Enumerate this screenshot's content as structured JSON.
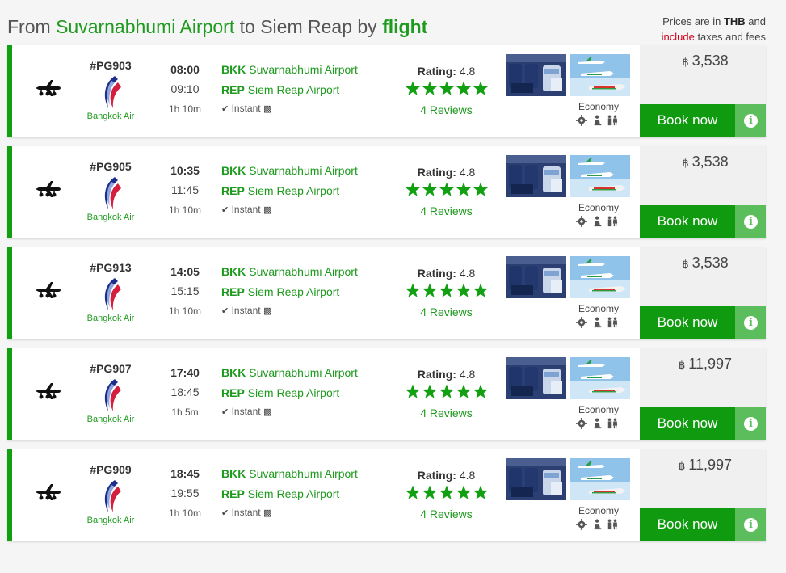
{
  "header": {
    "title_from": "From ",
    "title_origin": "Suvarnabhumi Airport",
    "title_to": " to ",
    "title_destination": "Siem Reap",
    "title_by": " by ",
    "title_mode": "flight",
    "prices_line1_prefix": "Prices are in ",
    "prices_currency": "THB",
    "prices_line1_suffix": " and",
    "prices_include": "include",
    "prices_line2_suffix": " taxes and fees"
  },
  "colors": {
    "accent_green": "#1e9a1e",
    "book_button": "#109a10",
    "info_button": "#5cbd5c",
    "note_red": "#d0021b"
  },
  "labels": {
    "rating_label": "Rating:",
    "instant_label": "Instant",
    "book_label": "Book now",
    "cabin_label": "Economy",
    "airline_name": "Bangkok Air",
    "dep_code": "BKK",
    "dep_airport": "Suvarnabhumi Airport",
    "arr_code": "REP",
    "arr_airport": "Siem Reap Airport",
    "currency_symbol": "฿",
    "info_symbol": "i"
  },
  "icons": {
    "transport": "airplane-icon",
    "instant": "check-icon",
    "luggage": "luggage-icon",
    "amenity1": "settings-icon",
    "amenity2": "seat-icon",
    "amenity3": "restroom-icon",
    "info": "info-icon"
  },
  "flights": [
    {
      "number": "#PG903",
      "depart": "08:00",
      "arrive": "09:10",
      "duration": "1h 10m",
      "rating": "4.8",
      "stars": 5,
      "reviews": "4 Reviews",
      "price": "3,538"
    },
    {
      "number": "#PG905",
      "depart": "10:35",
      "arrive": "11:45",
      "duration": "1h 10m",
      "rating": "4.8",
      "stars": 5,
      "reviews": "4 Reviews",
      "price": "3,538"
    },
    {
      "number": "#PG913",
      "depart": "14:05",
      "arrive": "15:15",
      "duration": "1h 10m",
      "rating": "4.8",
      "stars": 5,
      "reviews": "4 Reviews",
      "price": "3,538"
    },
    {
      "number": "#PG907",
      "depart": "17:40",
      "arrive": "18:45",
      "duration": "1h 5m",
      "rating": "4.8",
      "stars": 5,
      "reviews": "4 Reviews",
      "price": "11,997"
    },
    {
      "number": "#PG909",
      "depart": "18:45",
      "arrive": "19:55",
      "duration": "1h 10m",
      "rating": "4.8",
      "stars": 5,
      "reviews": "4 Reviews",
      "price": "11,997"
    }
  ]
}
